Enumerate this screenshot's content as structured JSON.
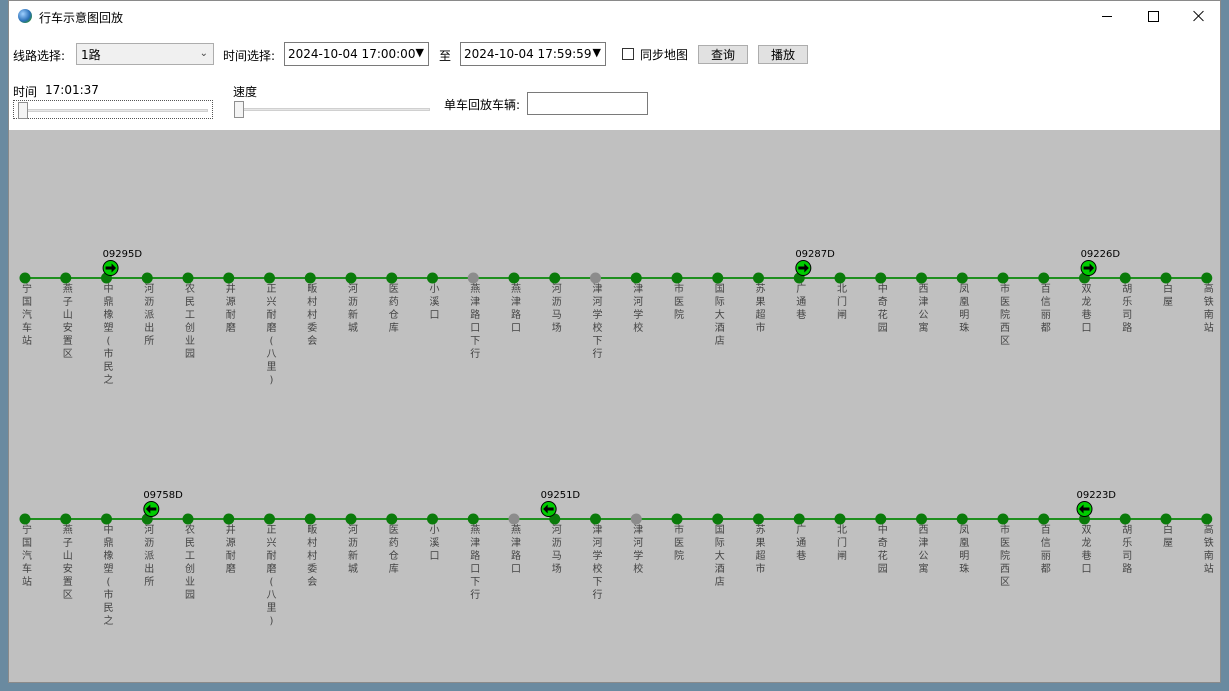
{
  "window": {
    "title": "行车示意图回放"
  },
  "toolbar": {
    "route_label": "线路选择:",
    "route_value": "1路",
    "time_label": "时间选择:",
    "start_time": "2024-10-04 17:00:00",
    "to_label": "至",
    "end_time": "2024-10-04 17:59:59",
    "sync_map_label": "同步地图",
    "sync_map_checked": false,
    "query_label": "查询",
    "play_label": "播放"
  },
  "playback": {
    "time_label": "时间",
    "current_time": "17:01:37",
    "speed_label": "速度",
    "single_vehicle_label": "单车回放车辆:",
    "single_vehicle_value": ""
  },
  "stations": [
    "宁国汽车站",
    "燕子山安置区",
    "中鼎橡塑(市民之",
    "河沥派出所",
    "农民工创业园",
    "井源耐磨",
    "正兴耐磨(八里)",
    "畈村村委会",
    "河沥新城",
    "医药仓库",
    "小溪口",
    "燕津路口下行",
    "燕津路口",
    "河沥马场",
    "津河学校下行",
    "津河学校",
    "市医院",
    "国际大酒店",
    "苏果超市",
    "广通巷",
    "北门闸",
    "中奇花园",
    "西津公寓",
    "凤凰明珠",
    "市医院西区",
    "百信丽都",
    "双龙巷口",
    "胡乐司路",
    "白屋",
    "高铁南站"
  ],
  "colors": {
    "station_active": "#0a7a0a",
    "station_inactive": "#8c8c8c",
    "line": "#1f8f1f",
    "bus": "#00cc00"
  },
  "up_line": {
    "inactive_stations": [
      11,
      14
    ],
    "buses": [
      {
        "id": "09295D",
        "position": 2.1,
        "direction": "right"
      },
      {
        "id": "09287D",
        "position": 19.1,
        "direction": "right"
      },
      {
        "id": "09226D",
        "position": 26.1,
        "direction": "right"
      }
    ]
  },
  "down_line": {
    "inactive_stations": [
      12,
      15
    ],
    "buses": [
      {
        "id": "09758D",
        "position": 3.1,
        "direction": "left"
      },
      {
        "id": "09251D",
        "position": 12.85,
        "direction": "left"
      },
      {
        "id": "09223D",
        "position": 26.0,
        "direction": "left"
      }
    ]
  }
}
